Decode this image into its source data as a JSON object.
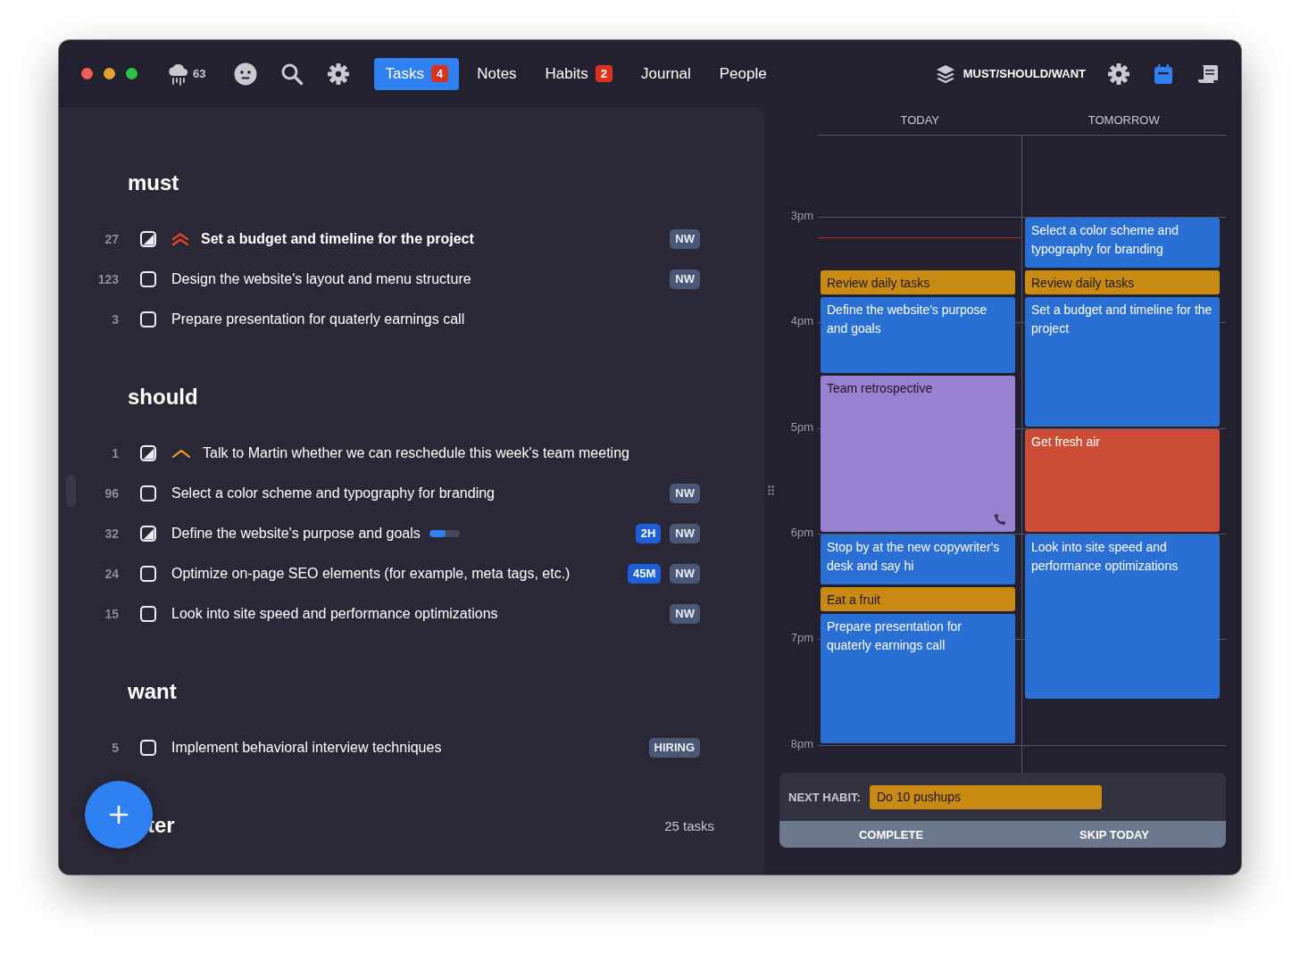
{
  "toolbar": {
    "weather": {
      "temperature": "63"
    },
    "tabs": [
      {
        "label": "Tasks",
        "badge": "4",
        "selected": true
      },
      {
        "label": "Notes",
        "selected": false
      },
      {
        "label": "Habits",
        "badge": "2",
        "selected": false
      },
      {
        "label": "Journal",
        "selected": false
      },
      {
        "label": "People",
        "selected": false
      }
    ],
    "view_label": "MUST/SHOULD/WANT",
    "view_buttons": [
      {
        "kind": "settings",
        "selected": false
      },
      {
        "kind": "calendar",
        "selected": true
      },
      {
        "kind": "notes",
        "selected": false
      }
    ]
  },
  "task_list": {
    "sections": [
      {
        "title": "must",
        "tasks": [
          {
            "number": "27",
            "started": true,
            "kind": "urgent",
            "title": "Set a budget and timeline for the project",
            "tags": [
              {
                "text": "NW",
                "kind": "tag"
              }
            ]
          },
          {
            "number": "123",
            "started": false,
            "title": "Design the website's layout and menu structure",
            "tags": [
              {
                "text": "NW",
                "kind": "tag"
              }
            ]
          },
          {
            "number": "3",
            "started": false,
            "title": "Prepare presentation for quaterly earnings call"
          }
        ]
      },
      {
        "title": "should",
        "tasks": [
          {
            "number": "1",
            "started": true,
            "kind": "important",
            "title": "Talk to Martin whether we can reschedule this week's team meeting"
          },
          {
            "number": "96",
            "started": false,
            "title": "Select a color scheme and typography for branding",
            "tags": [
              {
                "text": "NW",
                "kind": "tag"
              }
            ]
          },
          {
            "number": "32",
            "started": true,
            "title": "Define the website's purpose and goals",
            "level": 0.55,
            "tags": [
              {
                "text": "2H",
                "kind": "estimate"
              },
              {
                "text": "NW",
                "kind": "tag"
              }
            ]
          },
          {
            "number": "24",
            "started": false,
            "title": "Optimize on-page SEO elements (for example, meta tags, etc.)",
            "tags": [
              {
                "text": "45M",
                "kind": "estimate"
              },
              {
                "text": "NW",
                "kind": "tag"
              }
            ]
          },
          {
            "number": "15",
            "started": false,
            "title": "Look into site speed and performance optimizations",
            "tags": [
              {
                "text": "NW",
                "kind": "tag"
              }
            ]
          }
        ]
      },
      {
        "title": "want",
        "tasks": [
          {
            "number": "5",
            "started": false,
            "title": "Implement behavioral interview techniques",
            "tags": [
              {
                "text": "HIRING",
                "kind": "tag"
              }
            ]
          }
        ]
      }
    ],
    "partial_section_title": "ter",
    "task_count": "25 tasks"
  },
  "calendar": {
    "hours": [
      "3pm",
      "4pm",
      "5pm",
      "6pm",
      "7pm",
      "8pm"
    ],
    "days": [
      {
        "title": "TODAY",
        "current_time": true,
        "events": [
          {
            "title": "Review daily tasks",
            "color": "#c98a13",
            "call": false
          },
          {
            "title": "Define the website's purpose and goals",
            "color": "#2a6fd4",
            "call": false
          },
          {
            "title": "Team retrospective",
            "color": "#9781d0",
            "call": true
          },
          {
            "title": "Stop by at the new copywriter's desk and say hi",
            "color": "#2a6fd4",
            "call": false
          },
          {
            "title": "Eat a fruit",
            "color": "#c98a13",
            "call": false
          },
          {
            "title": "Prepare presentation for quaterly earnings call",
            "color": "#2a6fd4",
            "call": false
          }
        ]
      },
      {
        "title": "TOMORROW",
        "current_time": false,
        "events": [
          {
            "title": "Select a color scheme and typography for branding",
            "color": "#2a6fd4",
            "call": false
          },
          {
            "title": "Review daily tasks",
            "color": "#c98a13",
            "call": false
          },
          {
            "title": "Set a budget and timeline for the project",
            "color": "#2a6fd4",
            "call": false
          },
          {
            "title": "Get fresh air",
            "color": "#cc4d37",
            "call": false
          },
          {
            "title": "Look into site speed and performance optimizations",
            "color": "#2a6fd4",
            "call": false
          }
        ]
      }
    ]
  },
  "next_habit": {
    "label": "NEXT HABIT:",
    "value": "Do 10 pushups",
    "buttons": [
      "COMPLETE",
      "SKIP TODAY"
    ]
  }
}
